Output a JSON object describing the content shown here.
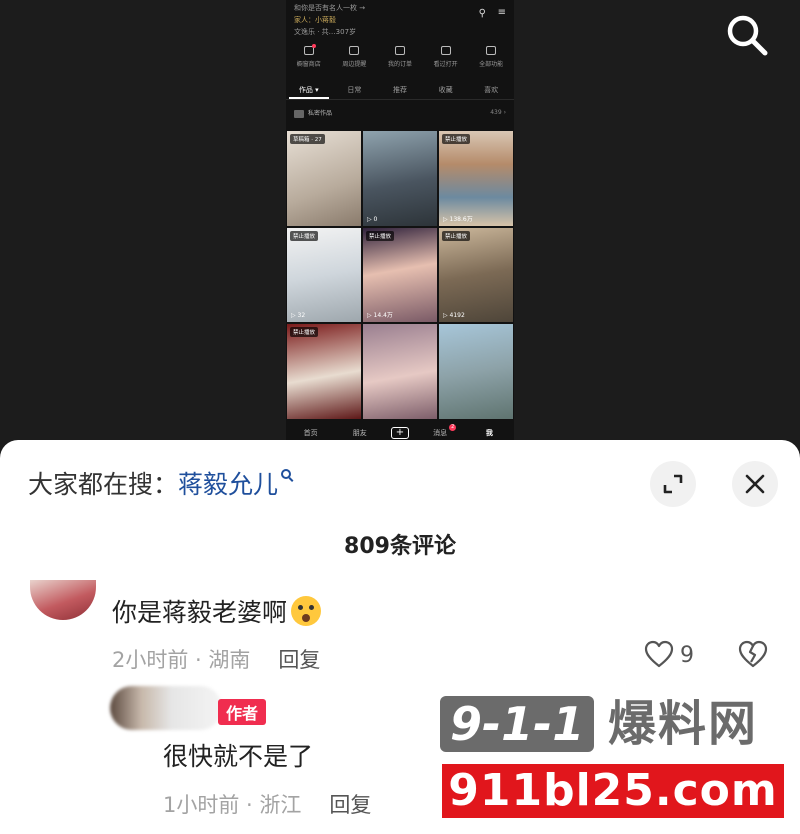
{
  "phone": {
    "header_line1": "和你是否有名人一枚 →",
    "header_line2": "家人：小蒋毅",
    "header_line3": "文逸乐 · 共…307岁",
    "tools": [
      {
        "label": "橱窗商店"
      },
      {
        "label": "周边提醒"
      },
      {
        "label": "我的订单"
      },
      {
        "label": "看过打开"
      },
      {
        "label": "全部功能"
      }
    ],
    "tabs": [
      "作品 ▾",
      "日常",
      "推荐",
      "收藏",
      "喜欢"
    ],
    "private_label": "私密作品",
    "private_count": "439 ›",
    "grid": [
      {
        "badge": "草稿箱 · 27",
        "play": ""
      },
      {
        "badge": "",
        "play": "▷ 0"
      },
      {
        "badge": "禁止播放",
        "play": "▷ 138.6万"
      },
      {
        "badge": "禁止播放",
        "play": "▷ 32"
      },
      {
        "badge": "禁止播放",
        "play": "▷ 14.4万"
      },
      {
        "badge": "禁止播放",
        "play": "▷ 4192"
      },
      {
        "badge": "禁止播放",
        "play": ""
      },
      {
        "badge": "",
        "play": ""
      },
      {
        "badge": "",
        "play": ""
      }
    ],
    "nav": {
      "home": "首页",
      "friends": "朋友",
      "plus": "+",
      "messages": "消息",
      "messages_badge": "2",
      "me": "我"
    }
  },
  "sheet": {
    "search_prefix": "大家都在搜：",
    "search_query": "蒋毅允儿",
    "comment_count": "809条评论",
    "comments": [
      {
        "text": "你是蒋毅老婆啊",
        "emoji_icon": "surprised-face-emoji",
        "time_location": "2小时前 · 湖南",
        "reply_label": "回复",
        "likes": "9"
      },
      {
        "author_badge": "作者",
        "text": "很快就不是了",
        "time_location": "1小时前 · 浙江",
        "reply_label": "回复"
      }
    ]
  },
  "watermark": {
    "logo": "9-1-1",
    "title": "爆料网",
    "domain": "911bl25.com"
  },
  "icons": {
    "top_right": "search-icon",
    "expand": "expand-icon",
    "close": "close-icon",
    "like": "heart-icon",
    "dislike": "broken-heart-icon"
  },
  "colors": {
    "link_blue": "#1f4f9c",
    "author_badge": "#f02d4f",
    "watermark_red": "#e1161c",
    "dark_bg": "#1c1c1c"
  }
}
